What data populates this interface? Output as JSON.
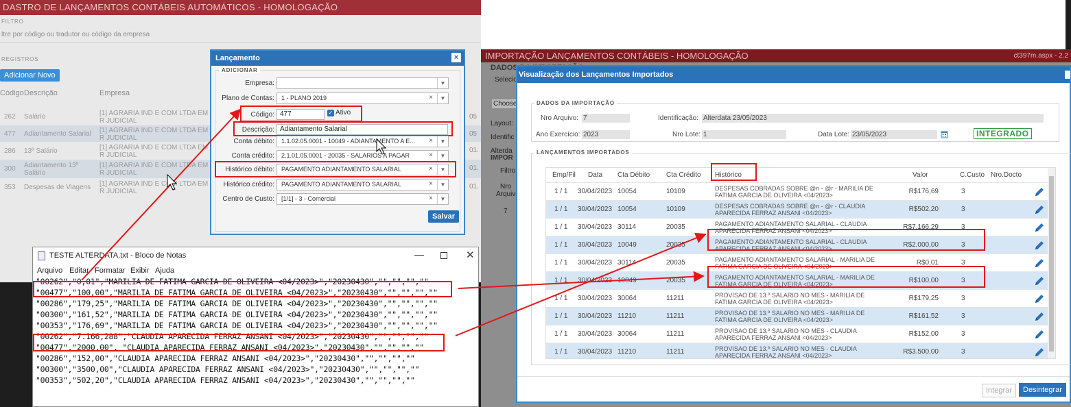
{
  "left_app": {
    "title": "DASTRO DE LANÇAMENTOS CONTÁBEIS AUTOMÁTICOS - HOMOLOGAÇÃO",
    "filter_section": "FILTRO",
    "filter_placeholder": "ltre por código ou tradutor ou código da empresa",
    "records_section": "REGISTROS",
    "add_button": "Adicionar Novo",
    "columns": [
      "Código",
      "Descrição",
      "Empresa"
    ],
    "rows": [
      {
        "code": "262",
        "desc": "Salário",
        "empresa": "[1] AGRARIA IND E COM LTDA EM R JUDICIAL",
        "extra": "05"
      },
      {
        "code": "477",
        "desc": "Adiantamento Salarial",
        "empresa": "[1] AGRARIA IND E COM LTDA EM R JUDICIAL",
        "extra": "05"
      },
      {
        "code": "286",
        "desc": "13º Salário",
        "empresa": "[1] AGRARIA IND E COM LTDA EM R JUDICIAL",
        "extra": "01."
      },
      {
        "code": "300",
        "desc": "Adiantamento 13º Salário",
        "empresa": "[1] AGRARIA IND E COM LTDA EM R JUDICIAL",
        "extra": "01."
      },
      {
        "code": "353",
        "desc": "Despesas de Viagens",
        "empresa": "[1] AGRARIA IND E COM LTDA EM R JUDICIAL",
        "extra": "01."
      }
    ]
  },
  "dialog": {
    "title": "Lançamento",
    "close": "×",
    "section": "ADICIONAR",
    "empresa_label": "Empresa:",
    "empresa_value": "",
    "plano_label": "Plano de Contas:",
    "plano_value": "1 - PLANO 2019",
    "codigo_label": "Código:",
    "codigo_value": "477",
    "ativo_label": "Ativo",
    "descricao_label": "Descrição:",
    "descricao_value": "Adiantamento Salarial",
    "conta_debito_label": "Conta débito:",
    "conta_debito_value": "1.1.02.05.0001 - 10049 - ADIANTAMENTO A E...",
    "conta_credito_label": "Conta crédito:",
    "conta_credito_value": "2.1.01.05.0001 - 20035 - SALARIOS A PAGAR",
    "hist_debito_label": "Histórico débito:",
    "hist_debito_value": "PAGAMENTO ADIANTAMENTO SALARIAL",
    "hist_credito_label": "Histórico crédito:",
    "hist_credito_value": "PAGAMENTO ADIANTAMENTO SALARIAL",
    "centro_label": "Centro de Custo:",
    "centro_value": "[1/1] - 3 - Comercial",
    "save": "Salvar",
    "clear_glyph": "×",
    "dropdown_glyph": "▼"
  },
  "notepad": {
    "title": "TESTE ALTERDATA.txt - Bloco de Notas",
    "menu": [
      "Arquivo",
      "Editar",
      "Formatar",
      "Exibir",
      "Ajuda"
    ],
    "lines": [
      "\"00262\",\"0,01\",\"MARILIA DE FATIMA GARCIA DE OLIVEIRA <04/2023>\",\"20230430\",\"\",\"\",\"\",\"\"",
      "\"00477\",\"100,00\",\"MARILIA DE FATIMA GARCIA DE OLIVEIRA <04/2023>\",\"20230430\",\"\",\"\",\"\",\"\"",
      "\"00286\",\"179,25\",\"MARILIA DE FATIMA GARCIA DE OLIVEIRA <04/2023>\",\"20230430\",\"\",\"\",\"\",\"\"",
      "\"00300\",\"161,52\",\"MARILIA DE FATIMA GARCIA DE OLIVEIRA <04/2023>\",\"20230430\",\"\",\"\",\"\",\"\"",
      "\"00353\",\"176,69\",\"MARILIA DE FATIMA GARCIA DE OLIVEIRA <04/2023>\",\"20230430\",\"\",\"\",\"\",\"\"",
      "\"00262\",\"7.166,288\",\"CLAUDIA APARECIDA FERRAZ ANSANI <04/2023>\",\"20230430\",\"\",\"\",\"\",\"\"",
      "\"00477\",\"2000,00\", \"CLAUDIA APARECIDA FERRAZ ANSANI <04/2023>\",\"20230430\",\"\",\"\",\"\",\"\"",
      "\"00286\",\"152,00\",\"CLAUDIA APARECIDA FERRAZ ANSANI <04/2023>\",\"20230430\",\"\",\"\",\"\",\"\"",
      "\"00300\",\"3500,00\",\"CLAUDIA APARECIDA FERRAZ ANSANI <04/2023>\",\"20230430\",\"\",\"\",\"\",\"\"",
      "\"00353\",\"502,20\",\"CLAUDIA APARECIDA FERRAZ ANSANI <04/2023>\",\"20230430\",\"\",\"\",\"\",\"\""
    ]
  },
  "right_app": {
    "title": "IMPORTAÇÃO LANÇAMENTOS CONTÁBEIS - HOMOLOGAÇÃO",
    "file": "ct397m.aspx - 2.2",
    "bg_labels": [
      "DADOS DA IMPORTAÇÃO",
      "Selecio",
      "Choose",
      "Layout:",
      "Identific",
      "Alterda",
      "IMPOR",
      "Filtro:",
      "Nro Arquivo",
      "7"
    ]
  },
  "viz": {
    "title": "Visualização dos Lançamentos Importados",
    "section1": "DADOS DA IMPORTAÇÃO",
    "nro_arquivo_label": "Nro Arquivo:",
    "nro_arquivo": "7",
    "identificacao_label": "Identificação:",
    "identificacao": "Alterdata 23/05/2023",
    "ano_label": "Ano Exercício:",
    "ano": "2023",
    "nro_lote_label": "Nro Lote:",
    "nro_lote": "1",
    "data_lote_label": "Data Lote:",
    "data_lote": "23/05/2023",
    "status": "INTEGRADO",
    "section2": "LANÇAMENTOS IMPORTADOS",
    "columns": [
      "Emp/Fil",
      "Data",
      "Cta Débito",
      "Cta Crédito",
      "Histórico",
      "Valor",
      "C.Custo",
      "Nro.Docto"
    ],
    "rows": [
      {
        "emp": "1 / 1",
        "data": "30/04/2023",
        "deb": "10054",
        "cred": "10109",
        "hist": "DESPESAS COBRADAS SOBRE @n - @r - MARILIA DE FATIMA GARCIA DE OLIVEIRA <04/2023>",
        "valor": "R$176,69",
        "cc": "3"
      },
      {
        "emp": "1 / 1",
        "data": "30/04/2023",
        "deb": "10054",
        "cred": "10109",
        "hist": "DESPESAS COBRADAS SOBRE @n - @r - CLAUDIA APARECIDA FERRAZ ANSANI <04/2023>",
        "valor": "R$502,20",
        "cc": "3"
      },
      {
        "emp": "1 / 1",
        "data": "30/04/2023",
        "deb": "30114",
        "cred": "20035",
        "hist": "PAGAMENTO ADIANTAMENTO SALARIAL - CLAUDIA APARECIDA FERRAZ ANSANI <04/2023>",
        "valor": "R$7.166,29",
        "cc": "3"
      },
      {
        "emp": "1 / 1",
        "data": "30/04/2023",
        "deb": "10049",
        "cred": "20035",
        "hist": "PAGAMENTO ADIANTAMENTO SALARIAL - CLAUDIA APARECIDA FERRAZ ANSANI <04/2023>",
        "valor": "R$2.000,00",
        "cc": "3"
      },
      {
        "emp": "1 / 1",
        "data": "30/04/2023",
        "deb": "30114",
        "cred": "20035",
        "hist": "PAGAMENTO ADIANTAMENTO SALARIAL - MARILIA DE FATIMA GARCIA DE OLIVEIRA <04/2023>",
        "valor": "R$0,01",
        "cc": "3"
      },
      {
        "emp": "1 / 1",
        "data": "30/04/2023",
        "deb": "10049",
        "cred": "20035",
        "hist": "PAGAMENTO ADIANTAMENTO SALARIAL - MARILIA DE FATIMA GARCIA DE OLIVEIRA <04/2023>",
        "valor": "R$100,00",
        "cc": "3"
      },
      {
        "emp": "1 / 1",
        "data": "30/04/2023",
        "deb": "30064",
        "cred": "11211",
        "hist": "PROVISAO DE 13.º SALARIO NO MES - MARILIA DE FATIMA GARCIA DE OLIVEIRA <04/2023>",
        "valor": "R$179,25",
        "cc": "3"
      },
      {
        "emp": "1 / 1",
        "data": "30/04/2023",
        "deb": "11210",
        "cred": "11211",
        "hist": "PROVISAO DE 13.º SALARIO NO MES - MARILIA DE FATIMA GARCIA DE OLIVEIRA <04/2023>",
        "valor": "R$161,52",
        "cc": "3"
      },
      {
        "emp": "1 / 1",
        "data": "30/04/2023",
        "deb": "30064",
        "cred": "11211",
        "hist": "PROVISAO DE 13.º SALARIO NO MES - CLAUDIA APARECIDA FERRAZ ANSANI <04/2023>",
        "valor": "R$152,00",
        "cc": "3"
      },
      {
        "emp": "1 / 1",
        "data": "30/04/2023",
        "deb": "11210",
        "cred": "11211",
        "hist": "PROVISAO DE 13.º SALARIO NO MES - CLAUDIA APARECIDA FERRAZ ANSANI <04/2023>",
        "valor": "R$3.500,00",
        "cc": "3"
      }
    ],
    "btn_integrar": "Integrar",
    "btn_desintegrar": "Desintegrar"
  },
  "colors": {
    "annotation": "#e01818",
    "primary": "#2b72b8",
    "left_title": "#a03038",
    "right_title": "#7c1a1f",
    "status_green": "#2e9e47"
  }
}
